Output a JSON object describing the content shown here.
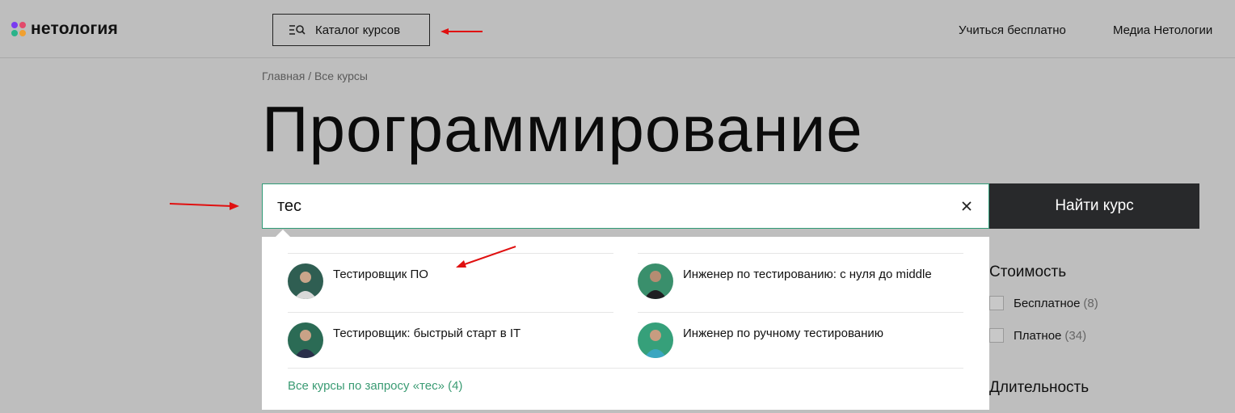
{
  "header": {
    "logo_text": "нетология",
    "catalog_label": "Каталог курсов",
    "nav": [
      "Учиться бесплатно",
      "Медиа Нетологии"
    ]
  },
  "breadcrumb": {
    "home": "Главная",
    "separator": "/",
    "current": "Все курсы"
  },
  "page_title": "Программирование",
  "search": {
    "value": "тес",
    "button_label": "Найти курс"
  },
  "suggestions": [
    {
      "title": "Тестировщик ПО",
      "avatar": "person-avatar-icon"
    },
    {
      "title": "Инженер по тестированию: с нуля до middle",
      "avatar": "person-avatar-icon"
    },
    {
      "title": "Тестировщик: быстрый старт в IT",
      "avatar": "person-avatar-icon"
    },
    {
      "title": "Инженер по ручному тестированию",
      "avatar": "person-avatar-icon"
    }
  ],
  "all_results_link": "Все курсы по запросу «тес» (4)",
  "filters": {
    "cost": {
      "heading": "Стоимость",
      "options": [
        {
          "label": "Бесплатное",
          "count": "(8)"
        },
        {
          "label": "Платное",
          "count": "(34)"
        }
      ]
    },
    "duration": {
      "heading": "Длительность"
    }
  },
  "colors": {
    "accent_green": "#3a9b73",
    "annotation_red": "#e01010",
    "dark_button": "#28292b",
    "overlay_gray": "#bebebe"
  }
}
